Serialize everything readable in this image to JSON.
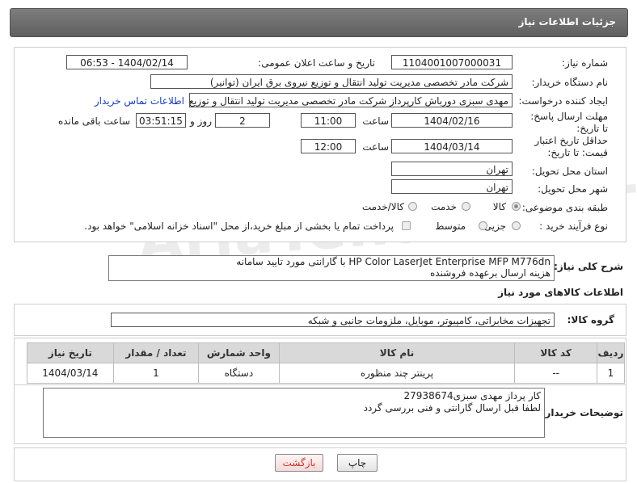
{
  "header": {
    "title": "جزئیات اطلاعات نیاز"
  },
  "watermark": {
    "text": "AriaTender.neT"
  },
  "form": {
    "need_number": {
      "label": "شماره نیاز:",
      "value": "1104001007000031"
    },
    "announce_datetime": {
      "label": "تاریخ و ساعت اعلان عمومی:",
      "value": "1404/02/14 - 06:53"
    },
    "buyer_org": {
      "label": "نام دستگاه خریدار:",
      "value": "شرکت مادر تخصصی مدیریت تولید  انتقال و توزیع نیروی برق ایران (توانیر)"
    },
    "requester": {
      "label": "ایجاد کننده درخواست:",
      "value": "مهدی سبزی دورباش کارپرداز شرکت مادر تخصصی مدیریت تولید  انتقال و توزیع نیروی برق ایران (توانیر)",
      "contact_link": "اطلاعات تماس خریدار"
    },
    "reply_deadline": {
      "label": "مهلت ارسال پاسخ: تا تاریخ:",
      "date": "1404/02/16",
      "time_label": "ساعت",
      "time": "11:00",
      "days": "2",
      "days_label": "روز و",
      "remaining": "03:51:15",
      "remaining_label": "ساعت باقی مانده"
    },
    "price_validity": {
      "label": "حداقل تاریخ اعتبار قیمت: تا تاریخ:",
      "date": "1404/03/14",
      "time_label": "ساعت",
      "time": "12:00"
    },
    "delivery_province": {
      "label": "استان محل تحویل:",
      "value": "تهران"
    },
    "delivery_city": {
      "label": "شهر محل تحویل:",
      "value": "تهران"
    },
    "category": {
      "label": "طبقه بندی موضوعی:",
      "options": [
        "کالا",
        "خدمت",
        "کالا/خدمت"
      ],
      "selected": "کالا"
    },
    "process_type": {
      "label": "نوع فرآیند خرید :",
      "options": [
        "جزیی",
        "متوسط"
      ],
      "note": "پرداخت تمام یا بخشی از مبلغ خرید،از محل \"اسناد خزانه اسلامی\" خواهد بود."
    }
  },
  "description": {
    "label": "شرح کلی نیاز:",
    "line1": "HP Color LaserJet Enterprise MFP M776dn با گارانتی مورد تایید سامانه",
    "line2": "هزینه ارسال برعهده فروشنده"
  },
  "goods_info": {
    "title": "اطلاعات کالاهای مورد نیاز"
  },
  "goods_group": {
    "label": "گروه کالا:",
    "value": "تجهیزات مخابراتی، کامپیوتر، موبایل، ملزومات جانبی و شبکه"
  },
  "table": {
    "headers": [
      "ردیف",
      "کد کالا",
      "نام کالا",
      "واحد شمارش",
      "تعداد / مقدار",
      "تاریخ نیاز"
    ],
    "rows": [
      [
        "1",
        "--",
        "پرینتر چند منظوره",
        "دستگاه",
        "1",
        "1404/03/14"
      ]
    ]
  },
  "buyer_notes": {
    "label": "توضیحات خریدار:",
    "line1": "کار پرداز مهدی سبزی27938674",
    "line2": "لطفا قبل ارسال گارانتی و فنی بررسی گردد"
  },
  "buttons": {
    "print": "چاپ",
    "back": "بازگشت"
  },
  "colors": {
    "header_bg": "#6e6e6e",
    "link": "#1a3fb5",
    "back_button_text": "#c0392b"
  }
}
